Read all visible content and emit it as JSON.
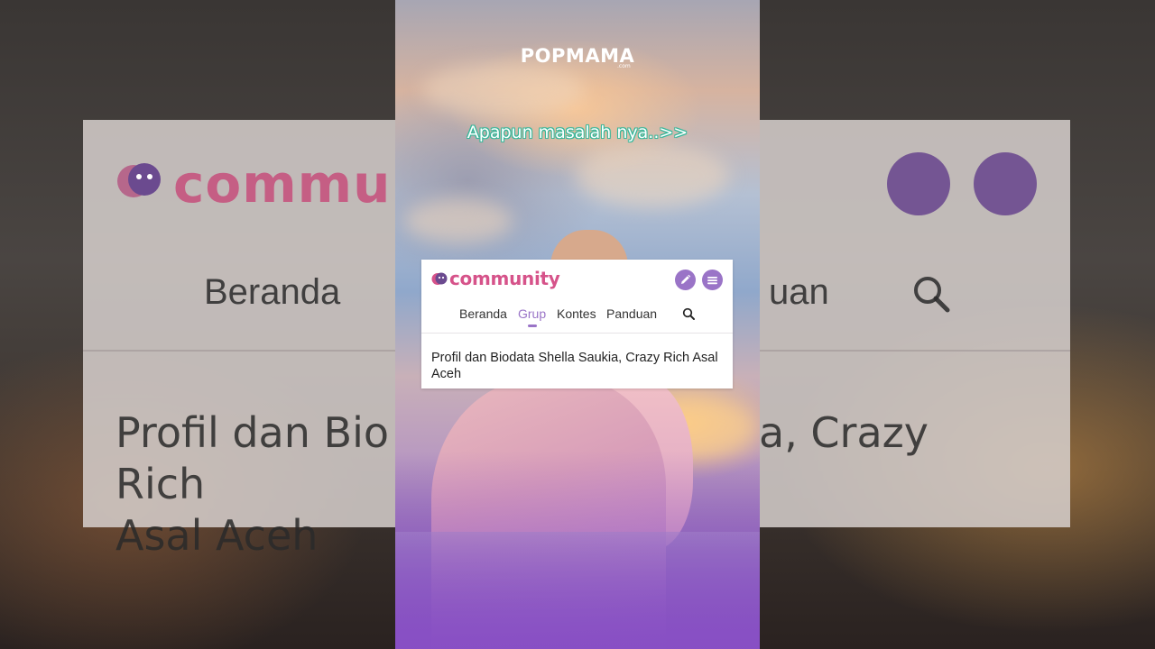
{
  "brand": {
    "name": "POPMAMA",
    "suffix": ".com"
  },
  "caption": "Apapun masalah nya..>>",
  "community": {
    "logo_text": "community",
    "edit_icon": "pencil-icon",
    "menu_icon": "hamburger-menu-icon",
    "nav": [
      {
        "label": "Beranda",
        "active": false
      },
      {
        "label": "Grup",
        "active": true
      },
      {
        "label": "Kontes",
        "active": false
      },
      {
        "label": "Panduan",
        "active": false
      }
    ],
    "search_icon": "search-icon",
    "article_title": "Profil dan Biodata Shella Saukia, Crazy Rich Asal Aceh"
  },
  "background": {
    "logo_text": "commu",
    "nav_left": "Beranda",
    "nav_right": "uan",
    "title_left": "Profil dan Bio",
    "title_right": "a, Crazy Rich",
    "title_line2": "Asal Aceh"
  },
  "colors": {
    "accent_purple": "#9a74c7",
    "brand_pink": "#d6538a",
    "caption_outline": "#35b79a"
  }
}
